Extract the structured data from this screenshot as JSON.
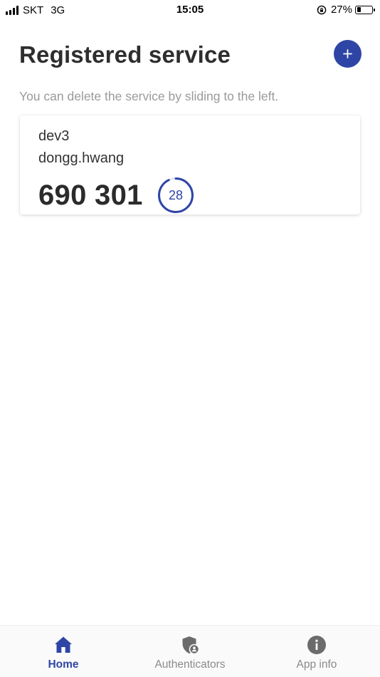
{
  "status_bar": {
    "carrier": "SKT",
    "network": "3G",
    "time": "15:05",
    "battery": "27%",
    "battery_level": 0.27,
    "icons": [
      "signal-icon",
      "orientation-lock-icon",
      "battery-icon"
    ]
  },
  "header": {
    "title": "Registered service",
    "add_icon": "plus-icon"
  },
  "hint": "You can delete the service by sliding to the left.",
  "services": [
    {
      "name": "dev3",
      "account": "dongg.hwang",
      "code": "690 301",
      "seconds_left": "28",
      "timer_progress": 0.93
    }
  ],
  "bottom_nav": {
    "items": [
      {
        "label": "Home",
        "icon": "home-icon",
        "active": true
      },
      {
        "label": "Authenticators",
        "icon": "shield-user-icon",
        "active": false
      },
      {
        "label": "App info",
        "icon": "info-icon",
        "active": false
      }
    ]
  },
  "colors": {
    "accent": "#2f45a6",
    "hint": "#9a9a9a",
    "inactive_nav": "#8a8a8a",
    "icon_gray": "#6b6b6b"
  }
}
